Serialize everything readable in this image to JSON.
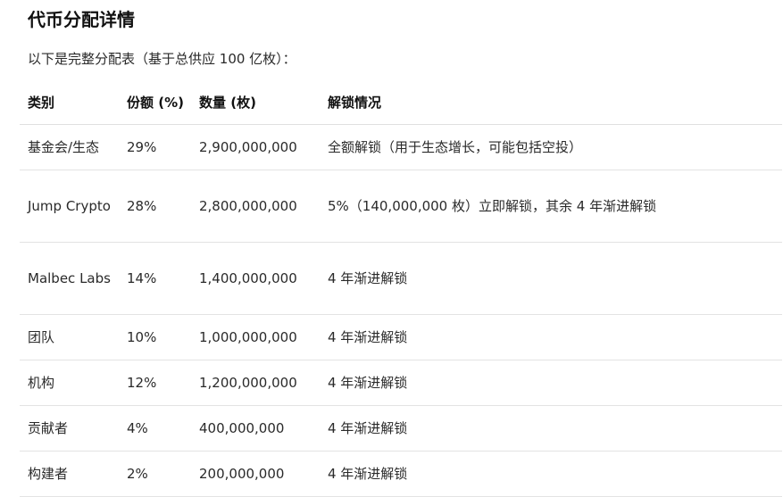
{
  "heading": "代币分配详情",
  "intro": "以下是完整分配表（基于总供应 100 亿枚）：",
  "table": {
    "headers": [
      "类别",
      "份额 (%)",
      "数量 (枚)",
      "解锁情况"
    ],
    "rows": [
      {
        "category": "基金会/生态",
        "share": "29%",
        "amount": "2,900,000,000",
        "unlock": "全额解锁（用于生态增长，可能包括空投）"
      },
      {
        "category": "Jump Crypto",
        "share": "28%",
        "amount": "2,800,000,000",
        "unlock": "5%（140,000,000 枚）立即解锁，其余 4 年渐进解锁"
      },
      {
        "category": "Malbec Labs",
        "share": "14%",
        "amount": "1,400,000,000",
        "unlock": "4 年渐进解锁"
      },
      {
        "category": "团队",
        "share": "10%",
        "amount": "1,000,000,000",
        "unlock": "4 年渐进解锁"
      },
      {
        "category": "机构",
        "share": "12%",
        "amount": "1,200,000,000",
        "unlock": "4 年渐进解锁"
      },
      {
        "category": "贡献者",
        "share": "4%",
        "amount": "400,000,000",
        "unlock": "4 年渐进解锁"
      },
      {
        "category": "构建者",
        "share": "2%",
        "amount": "200,000,000",
        "unlock": "4 年渐进解锁"
      }
    ]
  }
}
